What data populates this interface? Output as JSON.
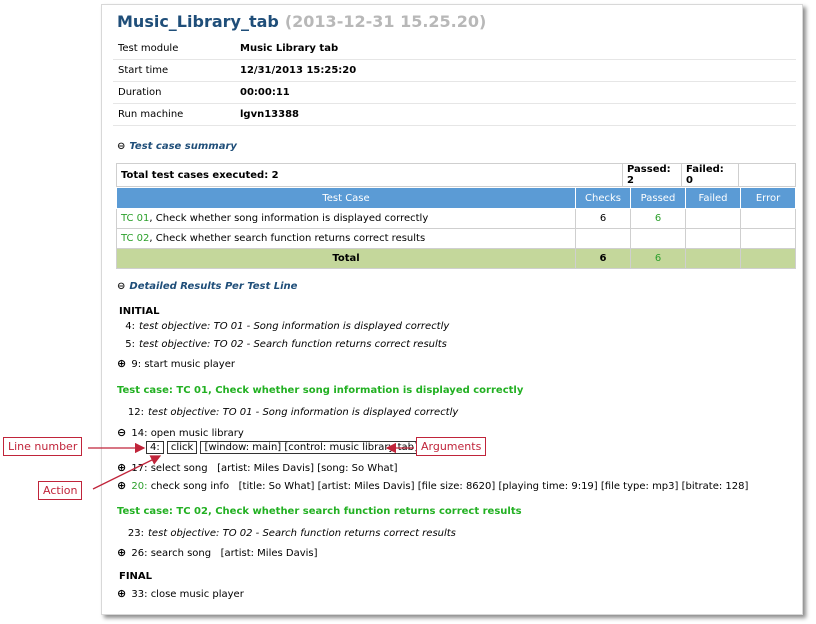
{
  "header": {
    "title": "Music_Library_tab",
    "timestamp": "(2013-12-31 15.25.20)"
  },
  "info": [
    {
      "label": "Test module",
      "value": "Music Library tab"
    },
    {
      "label": "Start time",
      "value": "12/31/2013 15:25:20"
    },
    {
      "label": "Duration",
      "value": "00:00:11"
    },
    {
      "label": "Run machine",
      "value": "lgvn13388"
    }
  ],
  "summary_section": {
    "toggle": "⊖",
    "title": "Test case summary"
  },
  "summary": {
    "total": "Total test cases executed: 2",
    "passed": "Passed: 2",
    "failed": "Failed: 0"
  },
  "table": {
    "headers": [
      "Test Case",
      "Checks",
      "Passed",
      "Failed",
      "Error"
    ],
    "rows": [
      {
        "id": "TC 01",
        "desc": ", Check whether song information is displayed correctly",
        "checks": "6",
        "passed": "6",
        "failed": "",
        "error": ""
      },
      {
        "id": "TC 02",
        "desc": ", Check whether search function returns correct results",
        "checks": "",
        "passed": "",
        "failed": "",
        "error": ""
      }
    ],
    "total": {
      "label": "Total",
      "checks": "6",
      "passed": "6",
      "failed": "",
      "error": ""
    }
  },
  "details_section": {
    "toggle": "⊖",
    "title": "Detailed Results Per Test Line"
  },
  "details": {
    "initial": "INITIAL",
    "l4": {
      "num": "4:",
      "text": "test objective: TO 01 - Song information is displayed correctly"
    },
    "l5": {
      "num": "5:",
      "text": "test objective: TO 02 - Search function returns correct results"
    },
    "l9": {
      "expander": "⊕",
      "num": "9:",
      "text": "start music player"
    },
    "tc1": "Test case: TC 01, Check whether song information is displayed correctly",
    "l12": {
      "num": "12:",
      "text": "test objective: TO 01 - Song information is displayed correctly"
    },
    "l14": {
      "expander": "⊖",
      "num": "14:",
      "text": "open music library"
    },
    "l4b": {
      "num": "4:",
      "action": "click",
      "args": "[window: main] [control: music library tab]"
    },
    "l17": {
      "expander": "⊕",
      "num": "17:",
      "text": "select song",
      "args": "[artist: Miles Davis] [song: So What]"
    },
    "l20": {
      "expander": "⊕",
      "num": "20:",
      "text": "check song info",
      "args": "[title: So What] [artist: Miles Davis] [file size: 8620] [playing time: 9:19] [file type: mp3] [bitrate: 128]"
    },
    "tc2": "Test case: TC 02, Check whether search function returns correct results",
    "l23": {
      "num": "23:",
      "text": "test objective: TO 02 - Search function returns correct results"
    },
    "l26": {
      "expander": "⊕",
      "num": "26:",
      "text": "search song",
      "args": "[artist: Miles Davis]"
    },
    "final": "FINAL",
    "l33": {
      "expander": "⊕",
      "num": "33:",
      "text": "close music player"
    }
  },
  "callouts": {
    "line_number": "Line number",
    "action": "Action",
    "arguments": "Arguments"
  },
  "colors": {
    "header_blue": "#5b9bd5",
    "total_green": "#c4d79b",
    "pass_green": "#2ca02c",
    "callout_red": "#c0243a"
  }
}
